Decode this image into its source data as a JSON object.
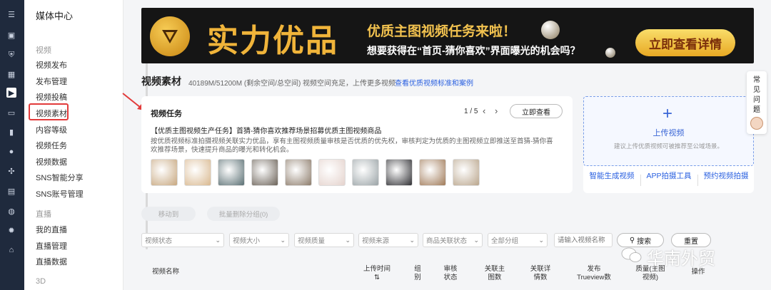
{
  "sidebar": {
    "title": "媒体中心",
    "sections": [
      {
        "label": "视频",
        "items": [
          "视频发布",
          "发布管理",
          "视频投稿",
          "视频素材",
          "内容等级",
          "视频任务",
          "视频数据",
          "SNS智能分享",
          "SNS账号管理"
        ]
      },
      {
        "label": "直播",
        "items": [
          "我的直播",
          "直播管理",
          "直播数据"
        ]
      },
      {
        "label": "3D",
        "items": []
      }
    ],
    "active_item": "视频素材"
  },
  "banner": {
    "title": "实力优品",
    "subtitle": "优质主图视频任务来啦！",
    "question": "想要获得在“首页-猜你喜欢”界面曝光的机会吗？",
    "cta": "立即查看详情"
  },
  "header": {
    "title": "视频素材",
    "quota": "40189M/51200M (剩余空间/总空间)",
    "tip": "视频空间充足，上传更多视频",
    "link": "查看优质视频标准和案例"
  },
  "task_card": {
    "title": "视频任务",
    "page": "1 / 5",
    "view_button": "立即查看",
    "headline": "【优质主图视频生产任务】首猜-猜你喜欢推荐场景招募优质主图视频商品",
    "description": "按优质视频标准拍摄视频关联实力优品，享有主图视频质量审核是否优质的优先权，审核判定为优质的主图视频立即推送至首猜-猜你喜欢推荐场景，快速提升商品的曝光和转化机会。",
    "thumbnail_colors": [
      "#c7a77f",
      "#d9b88f",
      "#5a6f73",
      "#6b6258",
      "#8c7b6a",
      "#e4d2cc",
      "#9aa3a6",
      "#2f2f33",
      "#a07a58",
      "#b9a58c"
    ]
  },
  "upload_card": {
    "label": "上传视频",
    "hint": "建议上传优质视频可被推荐至公域场景。",
    "actions": [
      "智能生成视频",
      "APP拍摄工具",
      "预约视频拍摄"
    ]
  },
  "help": {
    "label": "常见问题"
  },
  "bulk_actions": [
    "移动到",
    "批量删除分组(0)"
  ],
  "filters": {
    "selects": [
      "视频状态",
      "视频大小",
      "视频质量",
      "视频来源",
      "商品关联状态",
      "全部分组"
    ],
    "search_placeholder": "请输入视频名称",
    "search_button": "搜索",
    "reset_button": "重置"
  },
  "table": {
    "columns": [
      "视频名称",
      "上传时间",
      "组别",
      "审核状态",
      "关联主图数",
      "关联详情数",
      "发布Trueview数",
      "质量(主图视频)",
      "操作"
    ]
  },
  "watermark": "华南外贸",
  "colors": {
    "accent": "#2a60e0",
    "highlight": "#e23b3b",
    "rail": "#1f2a3d",
    "banner_gold": "#f0b43a"
  }
}
